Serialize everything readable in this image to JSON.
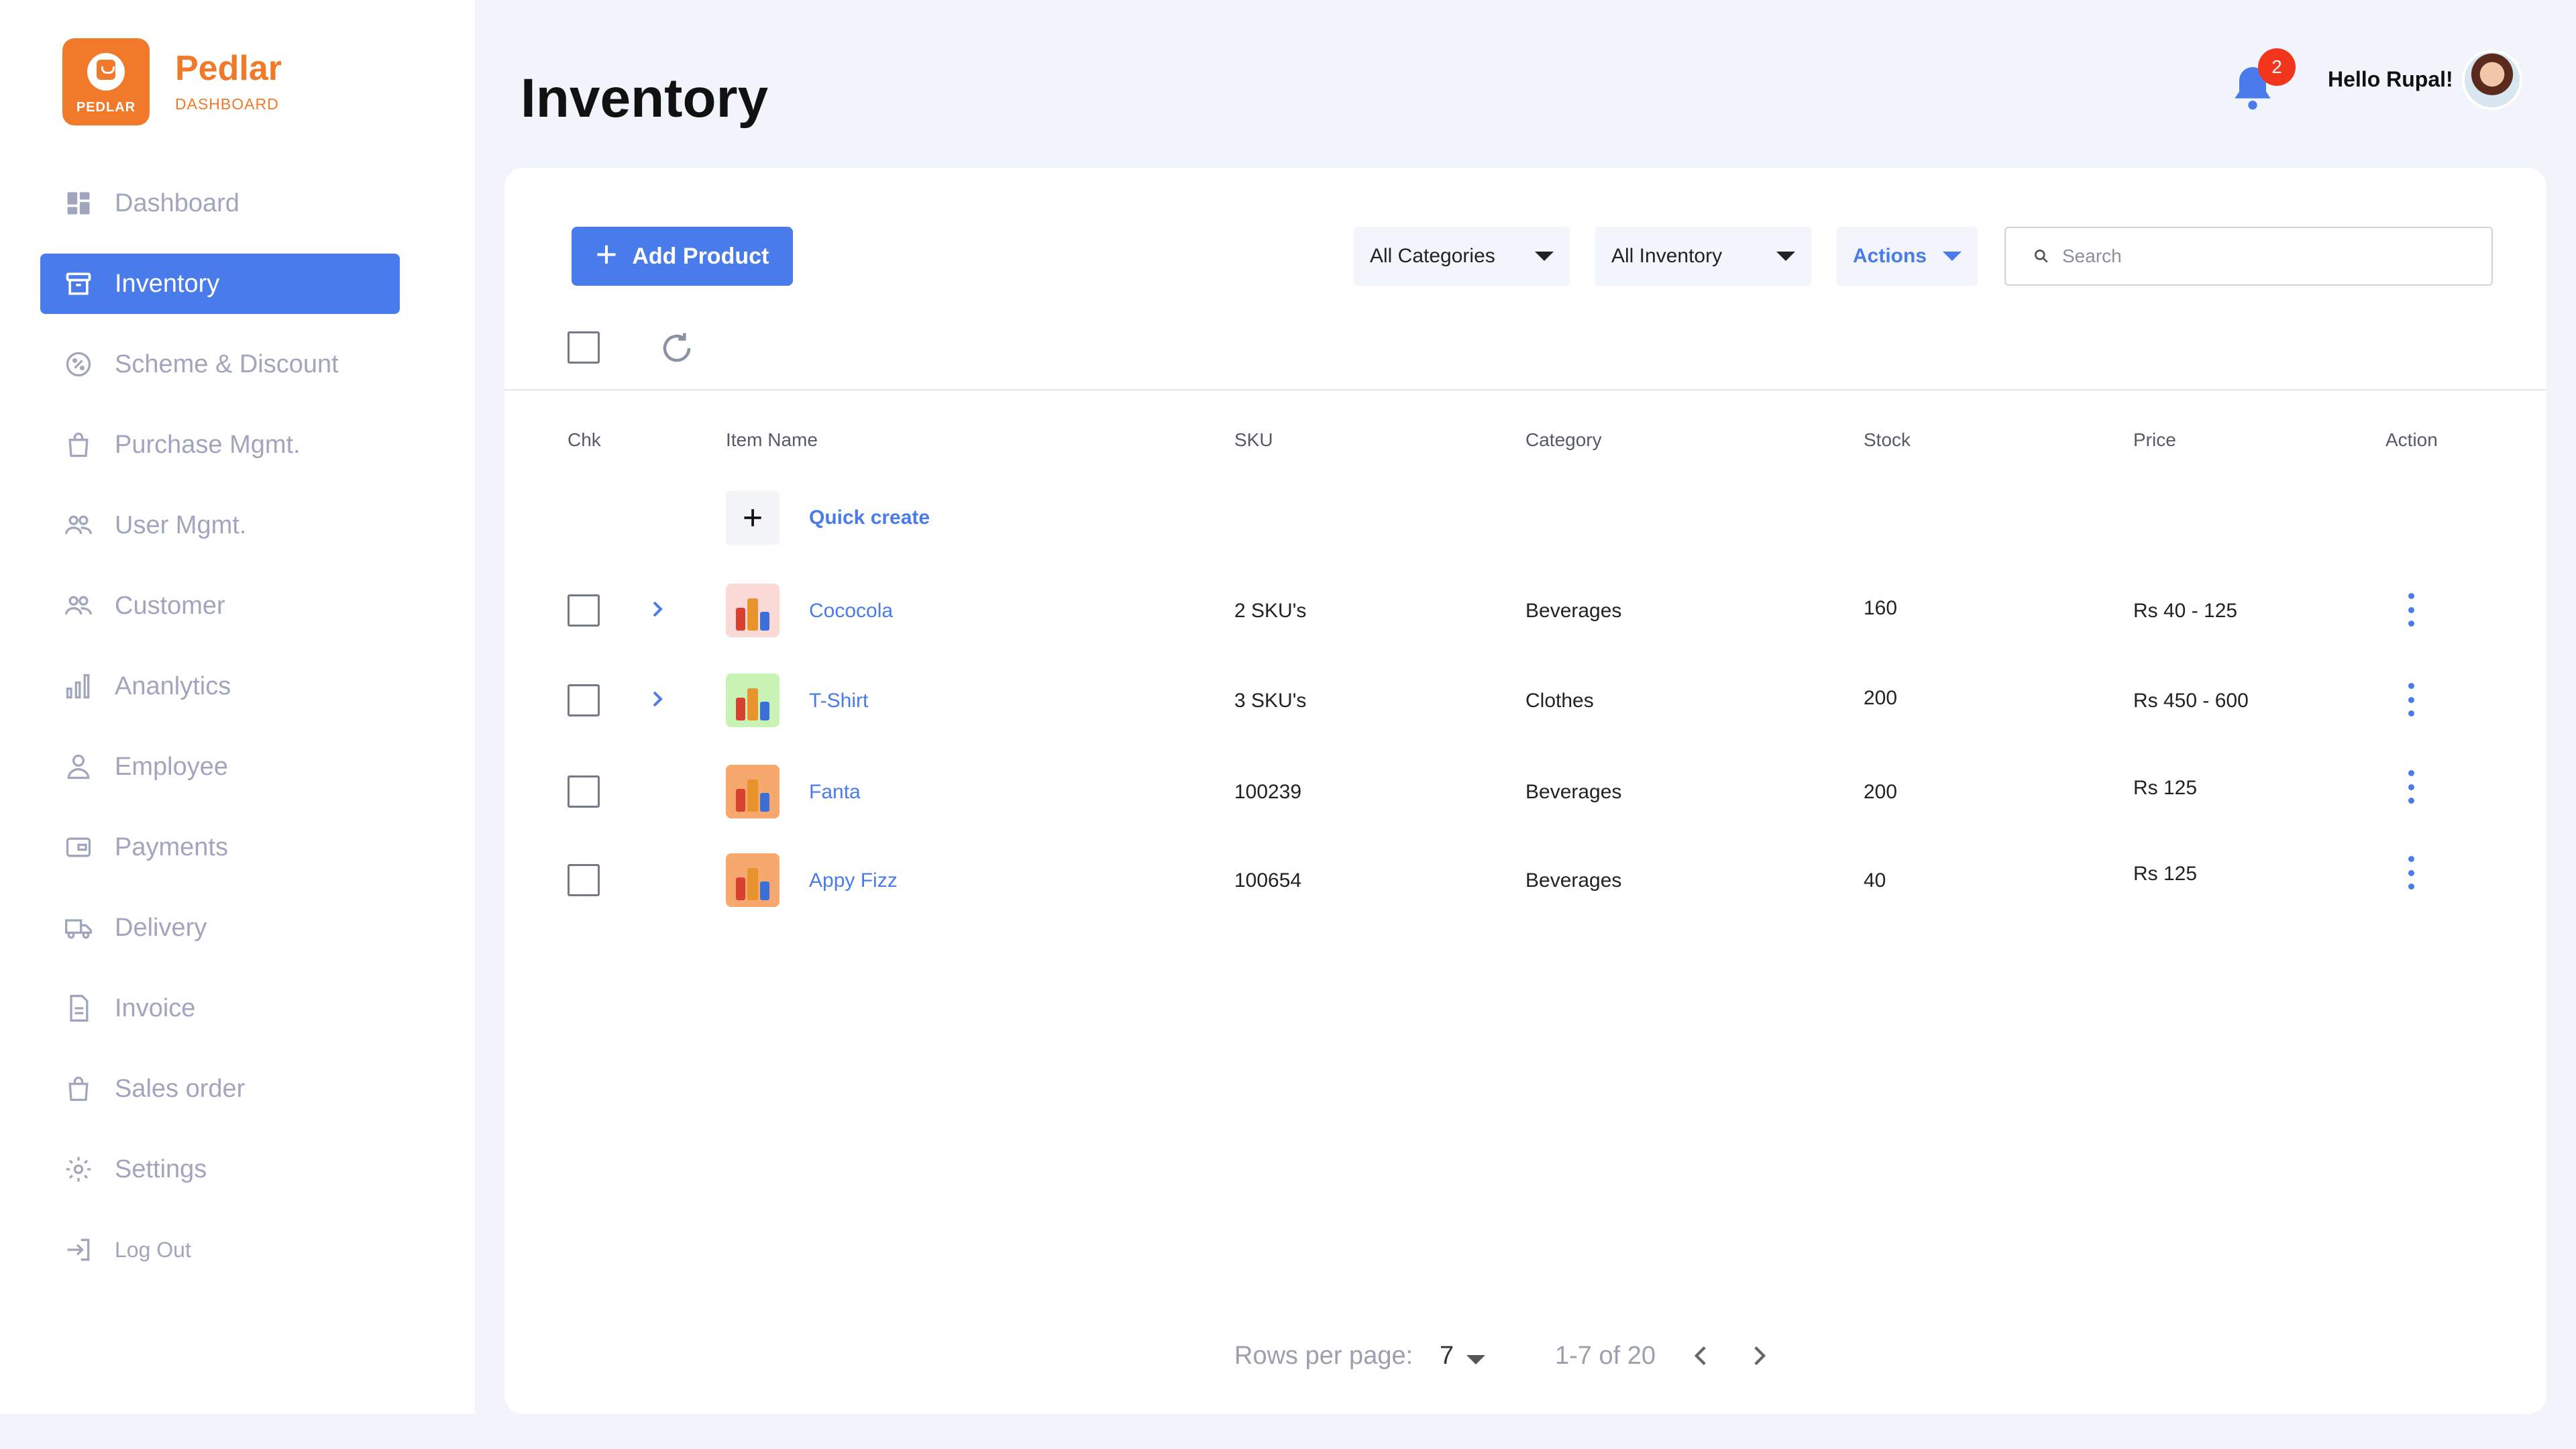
{
  "brand": {
    "logo_text": "PEDLAR",
    "name": "Pedlar",
    "sub": "DASHBOARD"
  },
  "sidebar": {
    "items": [
      {
        "label": "Dashboard",
        "icon": "dashboard-icon"
      },
      {
        "label": "Inventory",
        "icon": "inventory-icon",
        "active": true
      },
      {
        "label": "Scheme & Discount",
        "icon": "discount-icon"
      },
      {
        "label": "Purchase Mgmt.",
        "icon": "bag-icon"
      },
      {
        "label": "User Mgmt.",
        "icon": "users-icon"
      },
      {
        "label": "Customer",
        "icon": "customer-icon"
      },
      {
        "label": "Ananlytics",
        "icon": "analytics-icon"
      },
      {
        "label": "Employee",
        "icon": "employee-icon"
      },
      {
        "label": "Payments",
        "icon": "wallet-icon"
      },
      {
        "label": "Delivery",
        "icon": "truck-icon"
      },
      {
        "label": "Invoice",
        "icon": "invoice-icon"
      },
      {
        "label": "Sales order",
        "icon": "bag-icon"
      },
      {
        "label": "Settings",
        "icon": "gear-icon"
      },
      {
        "label": "Log Out",
        "icon": "logout-icon"
      }
    ]
  },
  "header": {
    "title": "Inventory",
    "notifications": "2",
    "greeting": "Hello Rupal!"
  },
  "toolbar": {
    "add_label": "Add Product",
    "categories": "All Categories",
    "inventory": "All Inventory",
    "actions": "Actions",
    "search_placeholder": "Search"
  },
  "table": {
    "columns": [
      "Chk",
      "Item Name",
      "SKU",
      "Category",
      "Stock",
      "Price",
      "Action"
    ],
    "quick_create": "Quick create",
    "rows": [
      {
        "name": "Cococola",
        "sku": "2 SKU's",
        "category": "Beverages",
        "stock": "160",
        "price": "Rs 40 - 125",
        "expandable": true,
        "thumb_bg": "#fbd9d6"
      },
      {
        "name": "T-Shirt",
        "sku": "3 SKU's",
        "category": "Clothes",
        "stock": "200",
        "price": "Rs 450 -  600",
        "expandable": true,
        "thumb_bg": "#c8f3b5"
      },
      {
        "name": "Fanta",
        "sku": "100239",
        "category": "Beverages",
        "stock": "200",
        "price": "Rs 125",
        "expandable": false,
        "thumb_bg": "#f7a86e"
      },
      {
        "name": "Appy Fizz",
        "sku": "100654",
        "category": "Beverages",
        "stock": "40",
        "price": "Rs 125",
        "expandable": false,
        "thumb_bg": "#f7a86e"
      }
    ]
  },
  "pagination": {
    "rows_label": "Rows per page:",
    "rows_value": "7",
    "range": "1-7 of 20"
  },
  "colors": {
    "accent": "#4a7bea",
    "brand": "#f07a2a",
    "badge": "#f2351d"
  }
}
